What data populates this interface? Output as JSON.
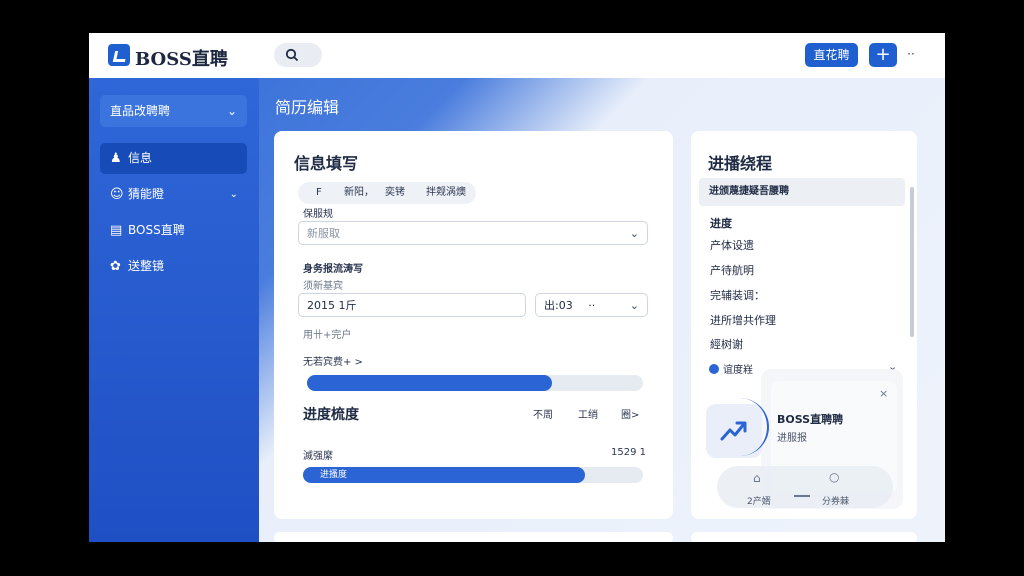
{
  "app": {
    "brand": "BOSS直聘",
    "header_button": "直花聘",
    "plus_label": "+",
    "more_label": "··"
  },
  "sidebar": {
    "selector_label": "直品改聘聘",
    "items": [
      {
        "icon": "user-icon",
        "label": "信息",
        "active": true
      },
      {
        "icon": "smiley-icon",
        "label": "猜能瞪",
        "has_chevron": true
      },
      {
        "icon": "document-icon",
        "label": "BOSS直聘"
      },
      {
        "icon": "settings-icon",
        "label": "送整镜"
      }
    ]
  },
  "page": {
    "title": "简历编辑"
  },
  "form": {
    "title": "信息填写",
    "chips": [
      "F",
      "新阳，",
      "奕铐",
      "拌觌涡燠"
    ],
    "field1_label": "保服规",
    "field1_placeholder": "新服取",
    "section2_label": "身务报流涛写",
    "section2_sublabel": "须新基宾",
    "year_value": "2015 1斤",
    "time_value": "出:03",
    "time_suffix": "··",
    "hint_text": "用卄+完户",
    "link_text": "无若宾费+ >",
    "progress1": 0.73,
    "section3_title": "进度梳度",
    "tab_a": "不周",
    "tab_b": "工绡",
    "tab_c": "圈>",
    "row_label": "滅强縻",
    "row_value": "1529 1",
    "progress2_label": "进搔度",
    "progress2": 0.83
  },
  "progress": {
    "title": "进播绕程",
    "header": "进颁蔑捷疑吾腰聘",
    "items": [
      "进度",
      "产体设遗",
      "产待航明",
      "完辅装调：",
      "进所增共作理",
      "經树谢"
    ],
    "select_label": "谊度嵀",
    "popup": {
      "title": "BOSS直聘聘",
      "subtitle": "进服报",
      "close": "×",
      "tab1": "2产婿",
      "tab2": "分券棘"
    }
  },
  "colors": {
    "accent": "#1f5fd0",
    "sidebar": "#2f67d8",
    "surface": "#ffffff"
  }
}
